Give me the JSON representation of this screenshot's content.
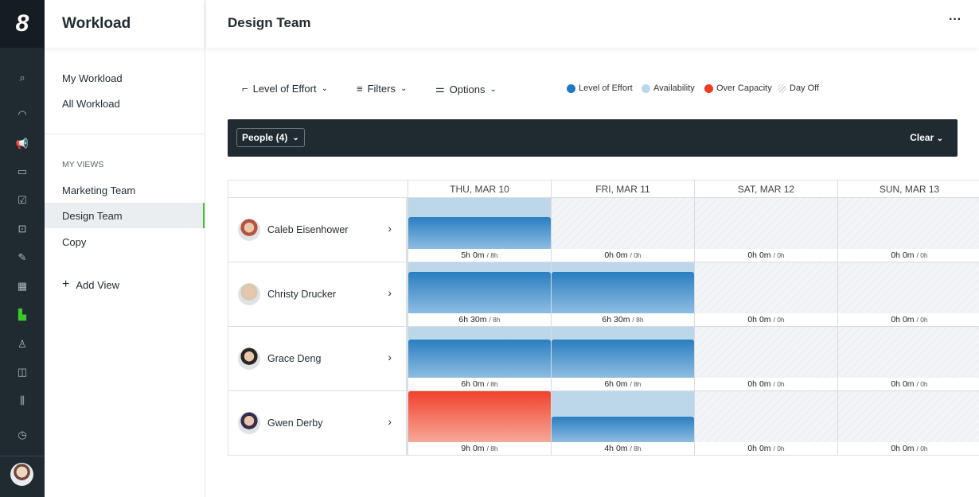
{
  "app": {
    "logo": "8"
  },
  "rail": [
    {
      "icon": "search-icon",
      "g": "⌕"
    },
    {
      "icon": "dashboard-icon",
      "g": "◠"
    },
    {
      "icon": "megaphone-icon",
      "g": "📢"
    },
    {
      "icon": "folder-icon",
      "g": "▭"
    },
    {
      "icon": "task-icon",
      "g": "☑"
    },
    {
      "icon": "inbox-icon",
      "g": "⊡"
    },
    {
      "icon": "proof-icon",
      "g": "✎"
    },
    {
      "icon": "calendar-icon",
      "g": "▦"
    },
    {
      "icon": "workload-icon",
      "g": "▙",
      "active": true
    },
    {
      "icon": "user-icon",
      "g": "♙"
    },
    {
      "icon": "layout-icon",
      "g": "◫"
    },
    {
      "icon": "reports-icon",
      "g": "⫼"
    },
    {
      "icon": "clock-icon",
      "g": "◷"
    }
  ],
  "sidebar": {
    "title": "Workload",
    "top": [
      "My Workload",
      "All Workload"
    ],
    "views_header": "MY VIEWS",
    "views": [
      "Marketing Team",
      "Design Team",
      "Copy"
    ],
    "selected": "Design Team",
    "add": "Add View"
  },
  "header": {
    "title": "Design Team",
    "more": "···"
  },
  "toolbar": {
    "effort": "Level of Effort",
    "filters": "Filters",
    "options": "Options"
  },
  "legend": [
    {
      "label": "Level of Effort",
      "color": "#1f7ac4"
    },
    {
      "label": "Availability",
      "color": "#bdd7ea"
    },
    {
      "label": "Over Capacity",
      "color": "#f03a22"
    },
    {
      "label": "Day Off",
      "color": "pattern"
    }
  ],
  "peoplebar": {
    "people": "People (4)",
    "clear": "Clear"
  },
  "days": [
    "THU, MAR 10",
    "FRI, MAR 11",
    "SAT, MAR 12",
    "SUN, MAR 13"
  ],
  "people": [
    {
      "name": "Caleb Eisenhower",
      "cells": [
        {
          "h": "5h 0m",
          "c": "8h",
          "v": 5,
          "cap": 8
        },
        {
          "h": "0h 0m",
          "c": "0h",
          "v": 0,
          "cap": 0
        },
        {
          "h": "0h 0m",
          "c": "0h",
          "v": 0,
          "cap": 0
        },
        {
          "h": "0h 0m",
          "c": "0h",
          "v": 0,
          "cap": 0
        }
      ]
    },
    {
      "name": "Christy Drucker",
      "cells": [
        {
          "h": "6h 30m",
          "c": "8h",
          "v": 6.5,
          "cap": 8
        },
        {
          "h": "6h 30m",
          "c": "8h",
          "v": 6.5,
          "cap": 8
        },
        {
          "h": "0h 0m",
          "c": "0h",
          "v": 0,
          "cap": 0
        },
        {
          "h": "0h 0m",
          "c": "0h",
          "v": 0,
          "cap": 0
        }
      ]
    },
    {
      "name": "Grace Deng",
      "cells": [
        {
          "h": "6h 0m",
          "c": "8h",
          "v": 6,
          "cap": 8
        },
        {
          "h": "6h 0m",
          "c": "8h",
          "v": 6,
          "cap": 8
        },
        {
          "h": "0h 0m",
          "c": "0h",
          "v": 0,
          "cap": 0
        },
        {
          "h": "0h 0m",
          "c": "0h",
          "v": 0,
          "cap": 0
        }
      ]
    },
    {
      "name": "Gwen Derby",
      "cells": [
        {
          "h": "9h 0m",
          "c": "8h",
          "v": 9,
          "cap": 8
        },
        {
          "h": "4h 0m",
          "c": "8h",
          "v": 4,
          "cap": 8
        },
        {
          "h": "0h 0m",
          "c": "0h",
          "v": 0,
          "cap": 0
        },
        {
          "h": "0h 0m",
          "c": "0h",
          "v": 0,
          "cap": 0
        }
      ]
    }
  ]
}
